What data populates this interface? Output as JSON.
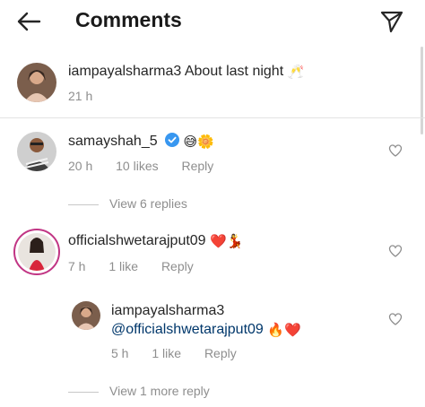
{
  "header": {
    "title": "Comments"
  },
  "caption": {
    "username": "iampayalsharma3",
    "text": "About last night",
    "emoji": "🥂",
    "time": "21 h"
  },
  "comments": [
    {
      "username": "samayshah_5",
      "emoji": "😅🌼",
      "time": "20 h",
      "likes": "10 likes",
      "reply": "Reply",
      "view_replies": "View 6 replies"
    },
    {
      "username": "officialshwetarajput09",
      "emoji": "❤️💃",
      "time": "7 h",
      "likes": "1 like",
      "reply": "Reply"
    }
  ],
  "reply": {
    "username": "iampayalsharma3",
    "mention": "@officialshwetarajput09",
    "emoji": "🔥❤️",
    "time": "5 h",
    "likes": "1 like",
    "reply": "Reply",
    "view_more": "View 1 more reply"
  },
  "colors": {
    "verified": "#3897f0",
    "heart_red": "#ed1c24",
    "story_ring": "#c13584"
  }
}
